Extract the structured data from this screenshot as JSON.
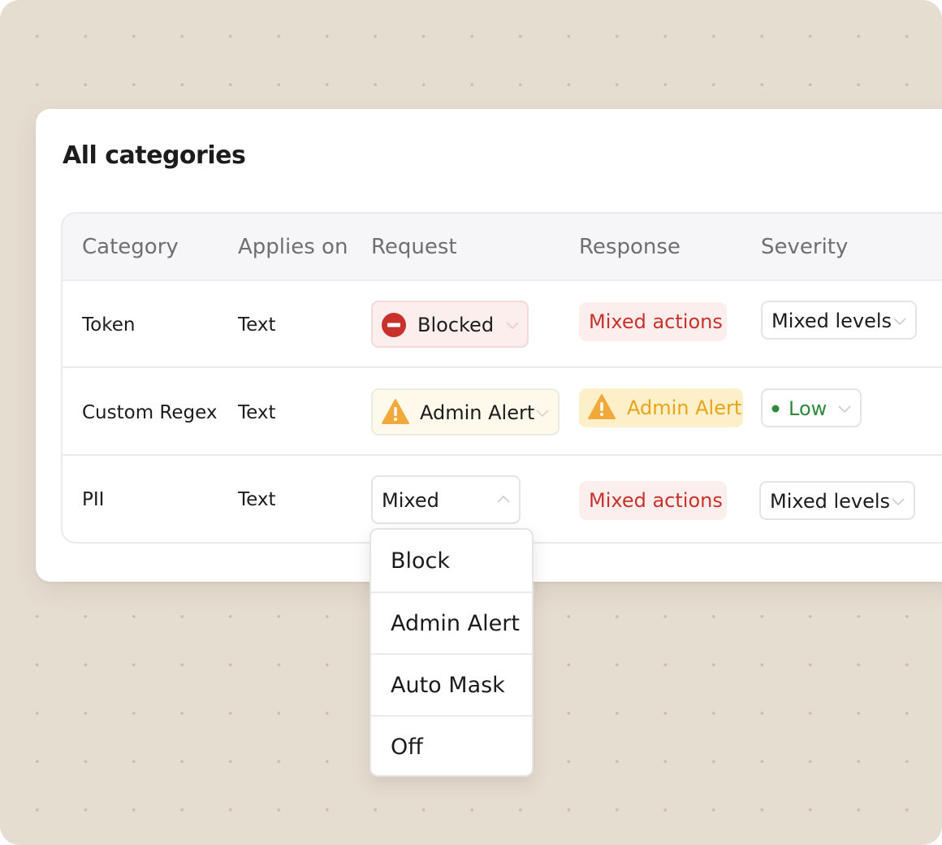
{
  "title": "All categories",
  "columns": [
    "Category",
    "Applies on",
    "Request",
    "Response",
    "Severity"
  ],
  "rows": [
    {
      "category": "Token",
      "applies_on": "Text",
      "request": {
        "label": "Blocked",
        "icon": "blocked-icon"
      },
      "response": {
        "label": "Mixed actions"
      },
      "severity": {
        "label": "Mixed levels"
      }
    },
    {
      "category": "Custom Regex",
      "applies_on": "Text",
      "request": {
        "label": "Admin Alert",
        "icon": "warning-icon"
      },
      "response": {
        "label": "Admin Alert",
        "icon": "warning-icon"
      },
      "severity": {
        "label": "Low",
        "icon": "green-dot-icon"
      }
    },
    {
      "category": "PII",
      "applies_on": "Text",
      "request": {
        "label": "Mixed",
        "state": "open"
      },
      "response": {
        "label": "Mixed actions"
      },
      "severity": {
        "label": "Mixed levels"
      }
    }
  ],
  "dropdown_options": [
    "Block",
    "Admin Alert",
    "Auto Mask",
    "Off"
  ],
  "colors": {
    "background": "#e6ddd1",
    "danger": "#c8322b",
    "danger_bg": "#fdeeee",
    "warning": "#e8a31c",
    "warning_bg": "#fdf0c8",
    "success": "#2f8a3a"
  }
}
